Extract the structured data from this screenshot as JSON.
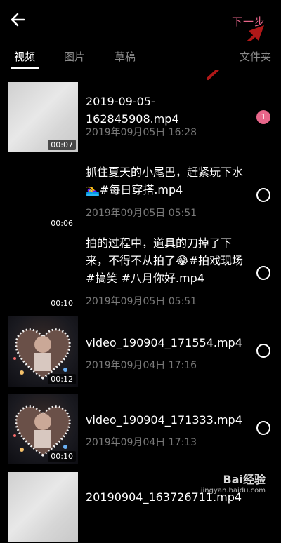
{
  "header": {
    "back_icon": "arrow-left-icon",
    "next_label": "下一步",
    "accent_color": "#e8668a"
  },
  "tabs": [
    {
      "label": "视频",
      "active": true
    },
    {
      "label": "图片",
      "active": false
    },
    {
      "label": "草稿",
      "active": false
    }
  ],
  "folder_tab": {
    "label": "文件夹"
  },
  "videos": [
    {
      "title": "2019-09-05-162845908.mp4",
      "date": "2019年09月05日 16:28",
      "duration": "00:07",
      "selected": true,
      "order": "1"
    },
    {
      "title": "抓住夏天的小尾巴，赶紧玩下水🏊‍♀️#每日穿搭.mp4",
      "date": "2019年09月05日 05:51",
      "duration": "00:06",
      "selected": false
    },
    {
      "title": "拍的过程中，道具的刀掉了下来，不得不从拍了😂#拍戏现场 #搞笑 #八月你好.mp4",
      "date": "2019年09月05日 05:51",
      "duration": "00:10",
      "selected": false
    },
    {
      "title": "video_190904_171554.mp4",
      "date": "2019年09月04日 17:16",
      "duration": "00:12",
      "selected": false
    },
    {
      "title": "video_190904_171333.mp4",
      "date": "2019年09月04日 17:13",
      "duration": "00:10",
      "selected": false
    },
    {
      "title": "20190904_163726711.mp4",
      "date": "",
      "duration": "",
      "selected": false
    }
  ],
  "watermark": {
    "logo": "Bai经验",
    "url": "jingyan.baidu.com"
  }
}
